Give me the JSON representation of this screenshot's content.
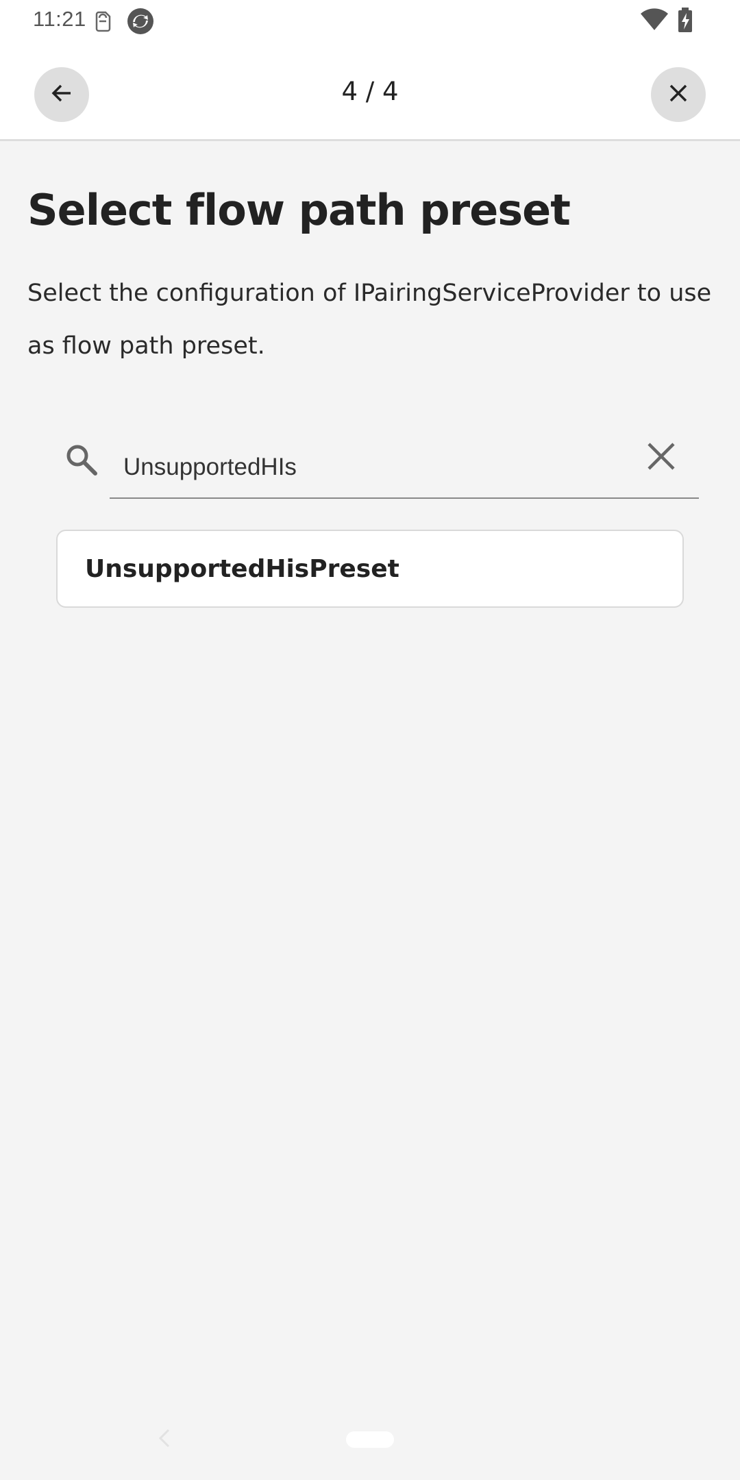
{
  "status_bar": {
    "time": "11:21",
    "icons": [
      "sim-icon",
      "sync-icon",
      "wifi-icon",
      "battery-charging-icon"
    ]
  },
  "header": {
    "step_indicator": "4 / 4",
    "back_icon": "arrow-left-icon",
    "close_icon": "close-icon"
  },
  "content": {
    "title": "Select flow path preset",
    "description": "Select the configuration of IPairingServiceProvider to use as flow path preset."
  },
  "search": {
    "value": "UnsupportedHIs",
    "search_icon": "search-icon",
    "clear_icon": "clear-icon"
  },
  "results": [
    {
      "label": "UnsupportedHisPreset"
    }
  ],
  "navigation_bar": {
    "back_icon": "nav-back-icon",
    "home_handle": "home-handle"
  },
  "colors": {
    "background": "#f4f4f4",
    "header_background": "#ffffff",
    "button_circle": "#dedede",
    "text_primary": "#222222"
  }
}
